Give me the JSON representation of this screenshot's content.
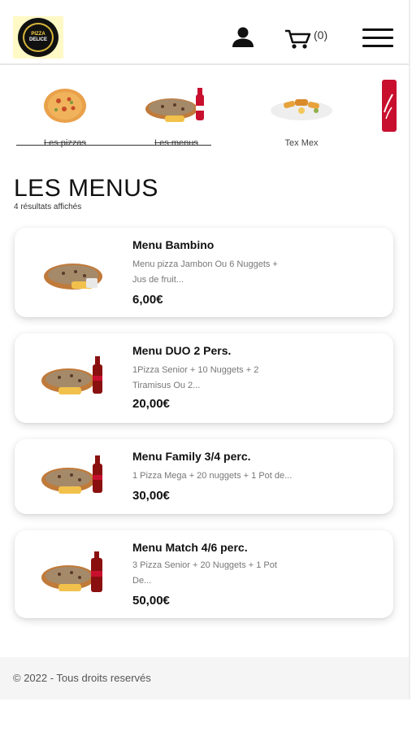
{
  "header": {
    "logo_line1": "PIZZA",
    "logo_line2": "DELICE",
    "cart_count": "(0)",
    "icons": [
      "user-icon",
      "cart-icon",
      "menu-icon"
    ]
  },
  "categories": [
    {
      "label": "Les pizzas",
      "icon": "pizza-image"
    },
    {
      "label": "Les menus",
      "icon": "menu-image"
    },
    {
      "label": "Tex Mex",
      "icon": "texmex-image"
    },
    {
      "label": "",
      "icon": "drink-image"
    }
  ],
  "main": {
    "title": "LES MENUS",
    "results": "4 résultats affichés"
  },
  "menus": [
    {
      "name": "Menu Bambino",
      "desc1": "Menu pizza Jambon Ou 6 Nuggets +",
      "desc2": "Jus de fruit...",
      "price": "6,00€"
    },
    {
      "name": "Menu DUO 2 Pers.",
      "desc1": "1Pizza Senior + 10 Nuggets + 2",
      "desc2": "Tiramisus Ou 2...",
      "price": "20,00€"
    },
    {
      "name": "Menu Family 3/4 perc.",
      "desc1": "1 Pizza Mega + 20 nuggets + 1 Pot de...",
      "desc2": "",
      "price": "30,00€"
    },
    {
      "name": "Menu Match 4/6 perc.",
      "desc1": "3 Pizza Senior + 20 Nuggets + 1 Pot",
      "desc2": "De...",
      "price": "50,00€"
    }
  ],
  "footer": {
    "text": "© 2022 - Tous droits reservés"
  },
  "colors": {
    "accent_yellow": "#ffd84a",
    "drink_red": "#c8102e",
    "text_dark": "#111111",
    "text_muted": "#777777"
  }
}
